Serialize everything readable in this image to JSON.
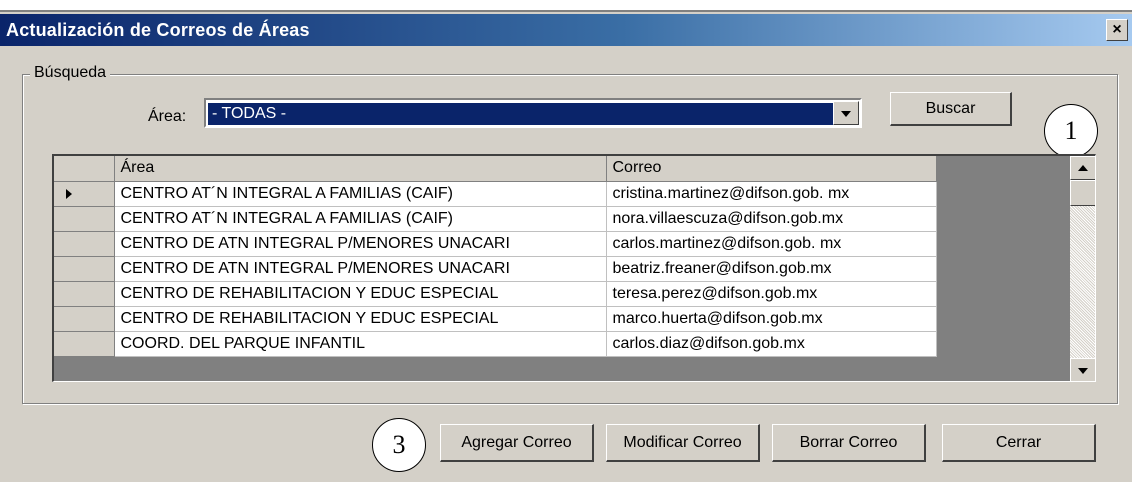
{
  "window": {
    "title": "Actualización de Correos de Áreas",
    "close_symbol": "×"
  },
  "search": {
    "group_label": "Búsqueda",
    "area_label": "Área:",
    "area_value": "- TODAS -",
    "search_button": "Buscar"
  },
  "callouts": {
    "c1": "1",
    "c3": "3"
  },
  "grid": {
    "columns": [
      "Área",
      "Correo"
    ],
    "rows": [
      {
        "area": "CENTRO AT´N INTEGRAL A FAMILIAS (CAIF)",
        "correo": "cristina.martinez@difson.gob. mx",
        "current": true
      },
      {
        "area": "CENTRO AT´N INTEGRAL A FAMILIAS (CAIF)",
        "correo": "nora.villaescuza@difson.gob.mx"
      },
      {
        "area": "CENTRO DE ATN INTEGRAL P/MENORES UNACARI",
        "correo": "carlos.martinez@difson.gob. mx"
      },
      {
        "area": "CENTRO DE ATN INTEGRAL P/MENORES UNACARI",
        "correo": "beatriz.freaner@difson.gob.mx"
      },
      {
        "area": "CENTRO DE REHABILITACION Y EDUC ESPECIAL",
        "correo": "teresa.perez@difson.gob.mx"
      },
      {
        "area": "CENTRO DE REHABILITACION Y EDUC ESPECIAL",
        "correo": "marco.huerta@difson.gob.mx"
      },
      {
        "area": "COORD. DEL PARQUE INFANTIL",
        "correo": "carlos.diaz@difson.gob.mx"
      }
    ]
  },
  "buttons": {
    "add": "Agregar Correo",
    "edit": "Modificar Correo",
    "delete": "Borrar Correo",
    "close": "Cerrar"
  },
  "colors": {
    "title_bar_start": "#0a246a",
    "title_bar_end": "#a6caf0",
    "window_face": "#d4d0c8",
    "selection": "#0a246a"
  }
}
